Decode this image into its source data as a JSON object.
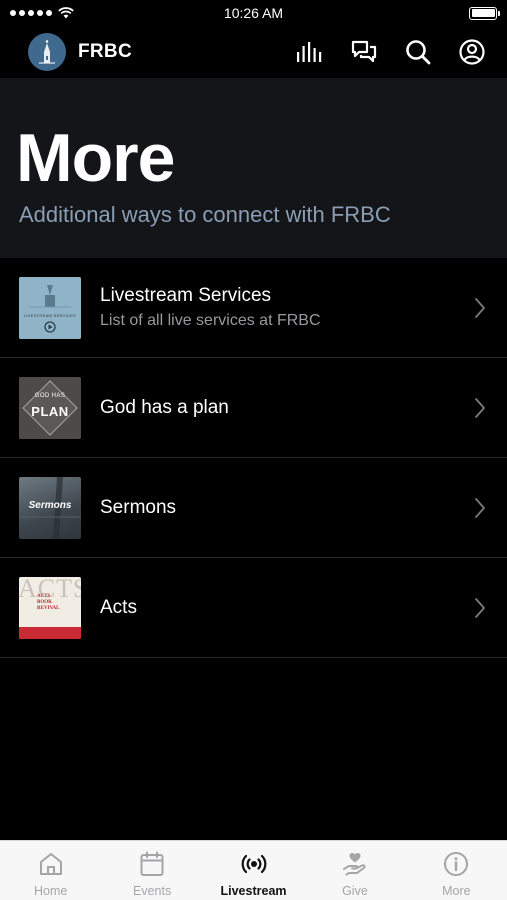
{
  "status_bar": {
    "time": "10:26 AM"
  },
  "header": {
    "app_name": "FRBC",
    "icons": [
      "bars-icon",
      "chat-icon",
      "search-icon",
      "account-icon"
    ]
  },
  "hero": {
    "title": "More",
    "subtitle": "Additional ways to connect with FRBC"
  },
  "list": {
    "items": [
      {
        "title": "Livestream Services",
        "subtitle": "List of all live services at FRBC",
        "thumb_caption": "LIVESTREAM SERVICES"
      },
      {
        "title": "God has a plan",
        "subtitle": "",
        "thumb_line1": "GOD HAS",
        "thumb_line2": "PLAN"
      },
      {
        "title": "Sermons",
        "subtitle": "",
        "thumb_caption": "Sermons"
      },
      {
        "title": "Acts",
        "subtitle": "",
        "thumb_big": "ACTS",
        "thumb_line1": "ACTS",
        "thumb_line2": "BOOK",
        "thumb_line3": "REVIVAL"
      }
    ]
  },
  "tab_bar": {
    "tabs": [
      {
        "label": "Home",
        "icon": "home-icon"
      },
      {
        "label": "Events",
        "icon": "calendar-icon"
      },
      {
        "label": "Livestream",
        "icon": "broadcast-icon",
        "active": true
      },
      {
        "label": "Give",
        "icon": "give-icon"
      },
      {
        "label": "More",
        "icon": "info-icon"
      }
    ]
  },
  "colors": {
    "background": "#000000",
    "hero_background": "#131518",
    "subtitle": "#8a9db4",
    "logo": "#3f6a8e",
    "tab_bar": "#f7f7f7",
    "tab_inactive": "#a5a5a8",
    "tab_active": "#111111"
  }
}
